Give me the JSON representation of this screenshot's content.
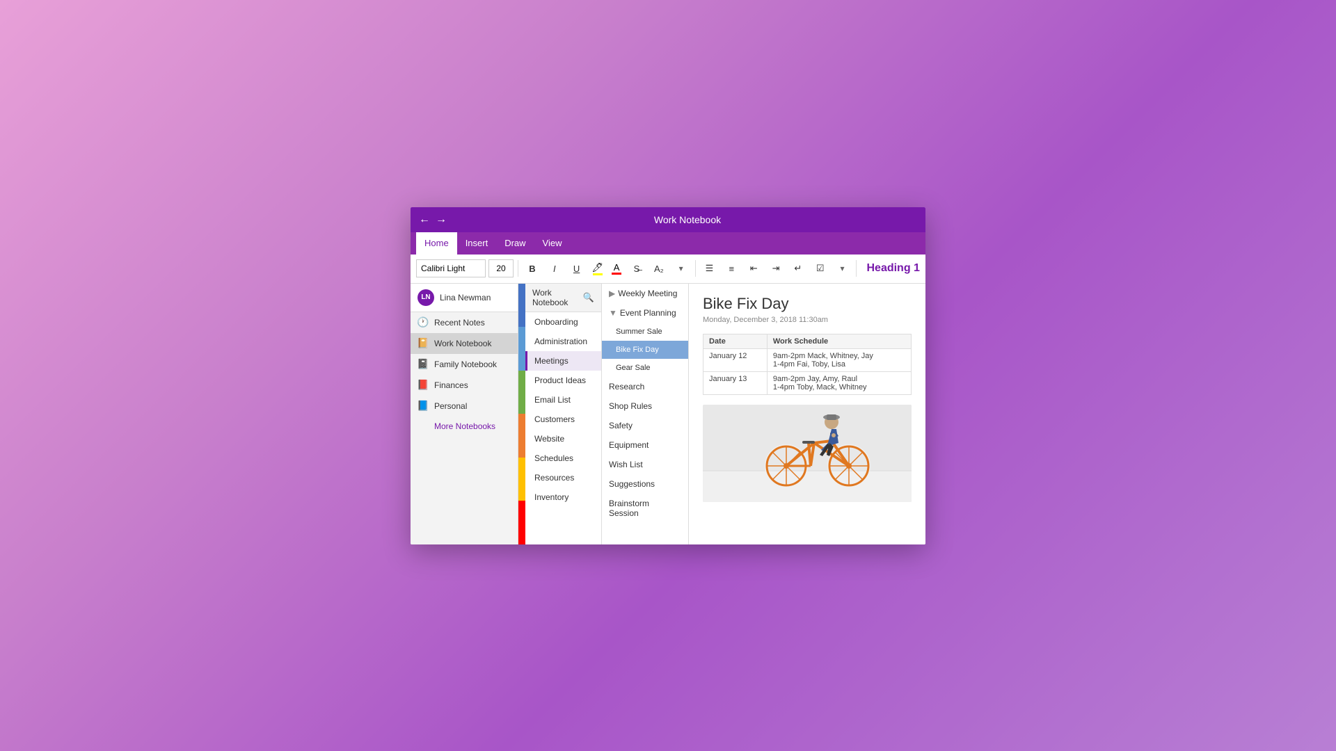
{
  "window": {
    "title": "Work Notebook",
    "nav_back": "←",
    "nav_forward": "→"
  },
  "menu": {
    "items": [
      "Home",
      "Insert",
      "Draw",
      "View"
    ],
    "active": "Home"
  },
  "toolbar": {
    "font": "Calibri Light",
    "font_size": "20",
    "bold": "B",
    "italic": "I",
    "underline": "U",
    "heading_style": "Heading 1",
    "more_btn": "▾"
  },
  "notebooks_panel": {
    "header_title": "Work Notebook",
    "user": {
      "initials": "LN",
      "name": "Lina Newman"
    },
    "items": [
      {
        "id": "recent",
        "label": "Recent Notes",
        "icon": "🕐"
      },
      {
        "id": "work",
        "label": "Work Notebook",
        "icon": "📔"
      },
      {
        "id": "family",
        "label": "Family Notebook",
        "icon": "📓"
      },
      {
        "id": "finances",
        "label": "Finances",
        "icon": "📕"
      },
      {
        "id": "personal",
        "label": "Personal",
        "icon": "📘"
      }
    ],
    "more": "More Notebooks"
  },
  "sections": {
    "items": [
      "Onboarding",
      "Administration",
      "Meetings",
      "Product Ideas",
      "Email List",
      "Customers",
      "Website",
      "Schedules",
      "Resources",
      "Inventory"
    ],
    "active": "Meetings"
  },
  "pages": {
    "items": [
      {
        "label": "Weekly Meeting",
        "level": 1,
        "hasArrow": true
      },
      {
        "label": "Event Planning",
        "level": 1,
        "hasArrow": true,
        "expanded": true
      },
      {
        "label": "Summer Sale",
        "level": 2
      },
      {
        "label": "Bike Fix Day",
        "level": 2,
        "active": true
      },
      {
        "label": "Gear Sale",
        "level": 2
      },
      {
        "label": "Research",
        "level": 1
      },
      {
        "label": "Shop Rules",
        "level": 1
      },
      {
        "label": "Safety",
        "level": 1
      },
      {
        "label": "Equipment",
        "level": 1
      },
      {
        "label": "Wish List",
        "level": 1
      },
      {
        "label": "Suggestions",
        "level": 1
      },
      {
        "label": "Brainstorm Session",
        "level": 1
      }
    ]
  },
  "note": {
    "title": "Bike Fix Day",
    "date": "Monday, December 3, 2018   11:30am",
    "schedule_headers": [
      "Date",
      "Work Schedule"
    ],
    "schedule_rows": [
      {
        "date": "January 12",
        "schedule": "9am-2pm Mack, Whitney, Jay\n1-4pm Fai, Toby, Lisa"
      },
      {
        "date": "January 13",
        "schedule": "9am-2pm Jay, Amy, Raul\n1-4pm Toby, Mack, Whitney"
      }
    ]
  },
  "section_tab_colors": [
    "#4472c4",
    "#70ad47",
    "#ed7d31",
    "#9966cc",
    "#cc6600",
    "#cc0000"
  ]
}
